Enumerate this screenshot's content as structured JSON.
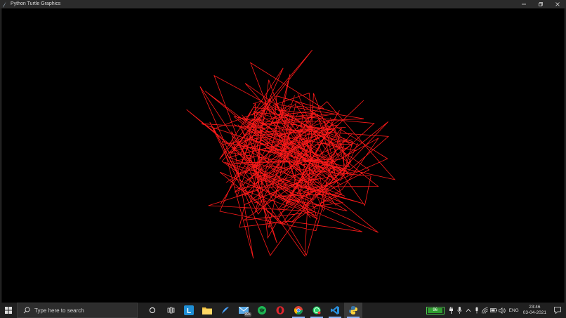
{
  "window": {
    "title": "Python Turtle Graphics",
    "minimize_icon": "minimize-icon",
    "restore_icon": "restore-icon",
    "close_icon": "close-icon"
  },
  "canvas": {
    "background": "#000000",
    "stroke_color": "#ff1a1a"
  },
  "taskbar": {
    "search_placeholder": "Type here to search",
    "apps": [
      {
        "name": "cortana-icon"
      },
      {
        "name": "task-view-icon"
      },
      {
        "name": "letter-l-app-icon",
        "label": "L"
      },
      {
        "name": "file-explorer-icon"
      },
      {
        "name": "feather-app-icon"
      },
      {
        "name": "mail-icon",
        "badge": "99+"
      },
      {
        "name": "spotify-icon"
      },
      {
        "name": "opera-icon"
      },
      {
        "name": "chrome-icon"
      },
      {
        "name": "whatsapp-icon"
      },
      {
        "name": "vscode-icon"
      },
      {
        "name": "python-turtle-icon"
      }
    ],
    "battery_percent": "96",
    "battery_level": 0.96,
    "language": "ENG",
    "time": "23:46",
    "date": "03-04-2021"
  }
}
